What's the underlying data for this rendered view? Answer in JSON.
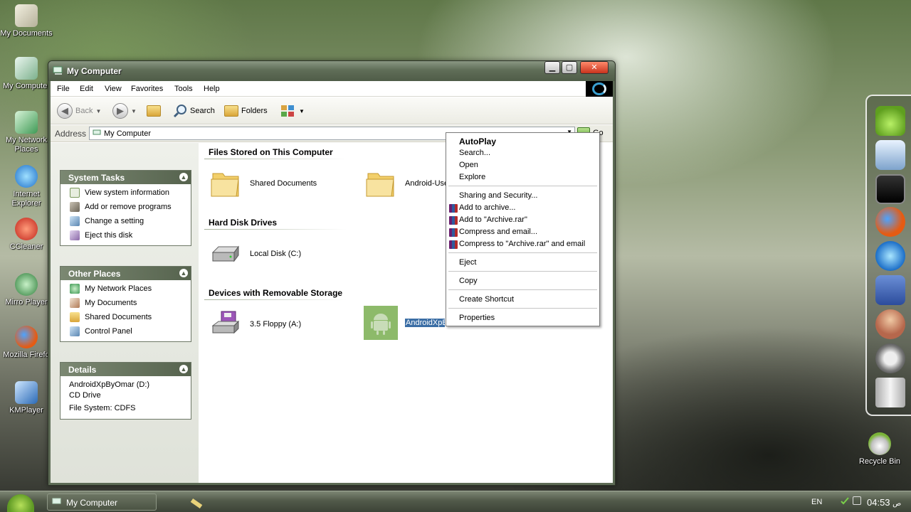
{
  "desktop": {
    "icons": [
      {
        "label": "My Documents"
      },
      {
        "label": "My Computer"
      },
      {
        "label": "My Network Places"
      },
      {
        "label": "Internet Explorer"
      },
      {
        "label": "CCleaner"
      },
      {
        "label": "Mirro Player"
      },
      {
        "label": "Mozilla Firefo"
      },
      {
        "label": "KMPlayer"
      }
    ],
    "recycle_bin": "Recycle Bin"
  },
  "window": {
    "title": "My Computer",
    "controls": {
      "minimize": "▁",
      "maximize": "▢",
      "close": "✕"
    },
    "menu": [
      "File",
      "Edit",
      "View",
      "Favorites",
      "Tools",
      "Help"
    ],
    "toolbar": {
      "back": "Back",
      "search": "Search",
      "folders": "Folders"
    },
    "address": {
      "label": "Address",
      "value": "My Computer",
      "go": "Go"
    }
  },
  "left_pane": {
    "system_tasks": {
      "title": "System Tasks",
      "items": [
        "View system information",
        "Add or remove programs",
        "Change a setting",
        "Eject this disk"
      ]
    },
    "other_places": {
      "title": "Other Places",
      "items": [
        "My Network Places",
        "My Documents",
        "Shared Documents",
        "Control Panel"
      ]
    },
    "details": {
      "title": "Details",
      "name": "AndroidXpByOmar (D:)",
      "type": "CD Drive",
      "filesystem": "File System: CDFS"
    }
  },
  "content": {
    "groups": [
      {
        "title": "Files Stored on This Computer",
        "items": [
          "Shared Documents",
          "Android-Use"
        ]
      },
      {
        "title": "Hard Disk Drives",
        "items": [
          "Local Disk (C:)"
        ]
      },
      {
        "title": "Devices with Removable Storage",
        "items": [
          "3.5 Floppy (A:)",
          "AndroidXpBy"
        ]
      }
    ]
  },
  "context_menu": {
    "items": [
      "AutoPlay",
      "Search...",
      "Open",
      "Explore",
      "Sharing and Security...",
      "Add to archive...",
      "Add to \"Archive.rar\"",
      "Compress and email...",
      "Compress to \"Archive.rar\" and email",
      "Eject",
      "Copy",
      "Create Shortcut",
      "Properties"
    ]
  },
  "taskbar": {
    "task": "My Computer",
    "lang": "EN",
    "time": "04:53",
    "ampm": "ص"
  },
  "dock_icons": [
    "android-icon",
    "computer-icon",
    "tablet-icon",
    "firefox-icon",
    "internet-explorer-icon",
    "facebook-icon",
    "user-icon",
    "settings-icon",
    "trash-icon"
  ]
}
